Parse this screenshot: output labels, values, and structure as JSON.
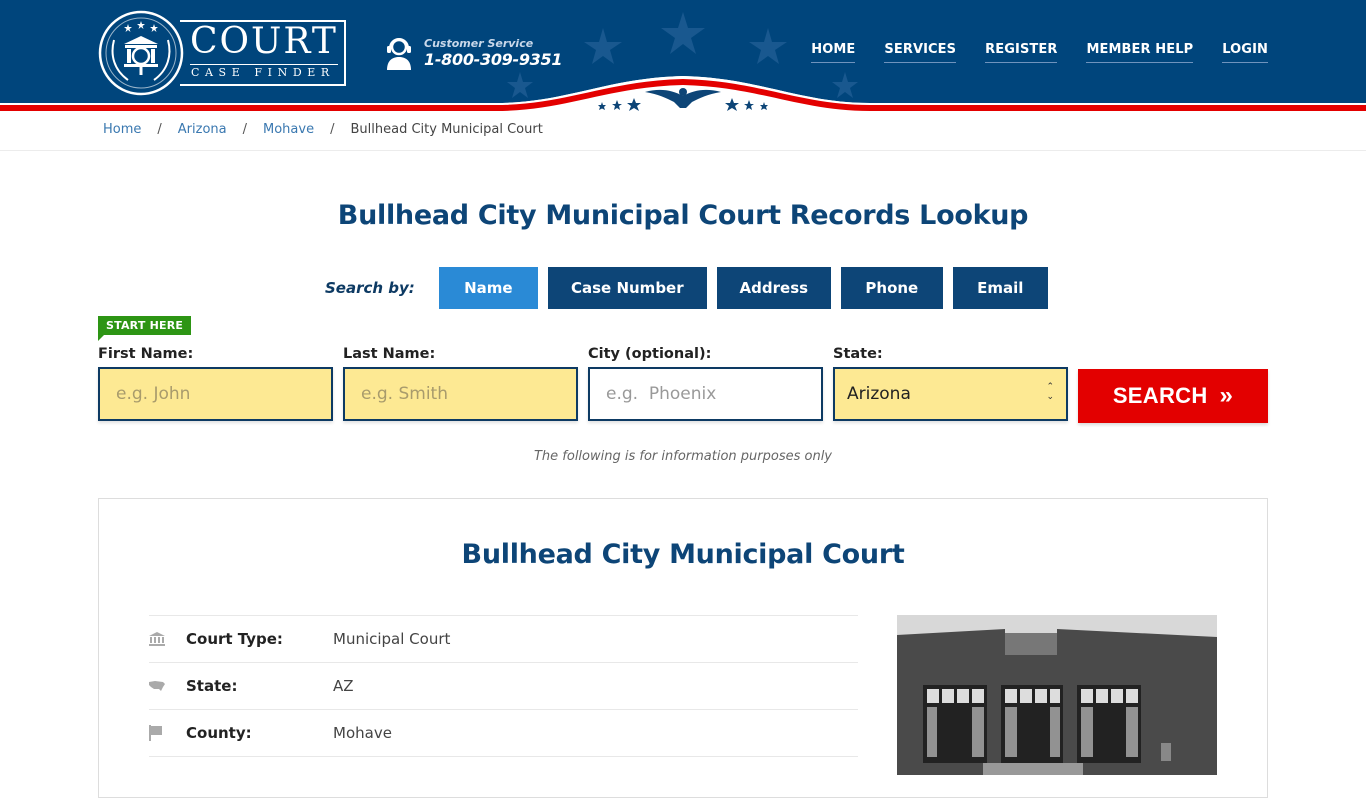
{
  "brand": {
    "name": "COURT",
    "tagline": "CASE FINDER"
  },
  "customer_service": {
    "label": "Customer Service",
    "phone": "1-800-309-9351"
  },
  "nav": {
    "items": [
      {
        "label": "HOME"
      },
      {
        "label": "SERVICES"
      },
      {
        "label": "REGISTER"
      },
      {
        "label": "MEMBER HELP"
      },
      {
        "label": "LOGIN"
      }
    ]
  },
  "breadcrumb": {
    "items": [
      "Home",
      "Arizona",
      "Mohave"
    ],
    "current": "Bullhead City Municipal Court",
    "separator": "/"
  },
  "page_title": "Bullhead City Municipal Court Records Lookup",
  "search": {
    "search_by_label": "Search by:",
    "tabs": [
      {
        "label": "Name",
        "active": true
      },
      {
        "label": "Case Number",
        "active": false
      },
      {
        "label": "Address",
        "active": false
      },
      {
        "label": "Phone",
        "active": false
      },
      {
        "label": "Email",
        "active": false
      }
    ],
    "start_here": "START HERE",
    "fields": {
      "first_name": {
        "label": "First Name:",
        "placeholder": "e.g. John",
        "value": ""
      },
      "last_name": {
        "label": "Last Name:",
        "placeholder": "e.g. Smith",
        "value": ""
      },
      "city": {
        "label": "City (optional):",
        "placeholder": "e.g.  Phoenix",
        "value": ""
      },
      "state": {
        "label": "State:",
        "selected": "Arizona"
      }
    },
    "button_label": "SEARCH",
    "button_icon": "double-chevron-right",
    "info_note": "The following is for information purposes only"
  },
  "court": {
    "title": "Bullhead City Municipal Court",
    "details": [
      {
        "icon": "courthouse-icon",
        "label": "Court Type:",
        "value": "Municipal Court"
      },
      {
        "icon": "usa-map-icon",
        "label": "State:",
        "value": "AZ"
      },
      {
        "icon": "flag-icon",
        "label": "County:",
        "value": "Mohave"
      }
    ],
    "photo_alt": "Bullhead City Municipal Court building"
  },
  "colors": {
    "header_blue": "#00457c",
    "accent_red": "#e30000",
    "title_blue": "#0d4577",
    "tab_active": "#2a8ad6",
    "input_yellow": "#fde993",
    "start_here_green": "#2d9514"
  }
}
